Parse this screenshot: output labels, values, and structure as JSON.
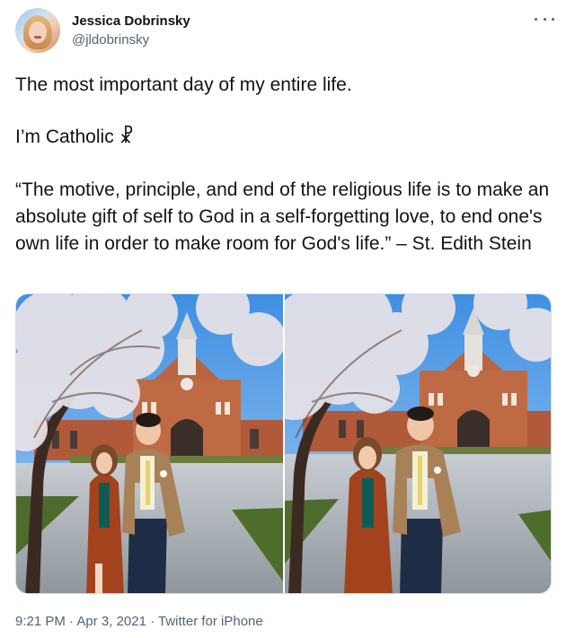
{
  "author": {
    "name": "Jessica Dobrinsky",
    "handle": "@jldobrinsky"
  },
  "more_icon": "more-horizontal-icon",
  "tweet": {
    "line1": "The most important day of my entire life.",
    "line2": "I’m Catholic ☧",
    "quote": "“The motive, principle, and end of the religious life is to make an absolute gift of self to God in a self-forgetting love, to end one's own life in order to make room for God's life.” – St. Edith Stein"
  },
  "media": {
    "count": 2,
    "scene": "couple in front of brick church with blossoming tree"
  },
  "meta": {
    "time": "9:21 PM",
    "sep1": " · ",
    "date": "Apr 3, 2021",
    "sep2": " · ",
    "source": "Twitter for iPhone"
  },
  "colors": {
    "text": "#0f1419",
    "secondary": "#536471",
    "sky": "#5aa0e6",
    "brick": "#b8603d"
  }
}
